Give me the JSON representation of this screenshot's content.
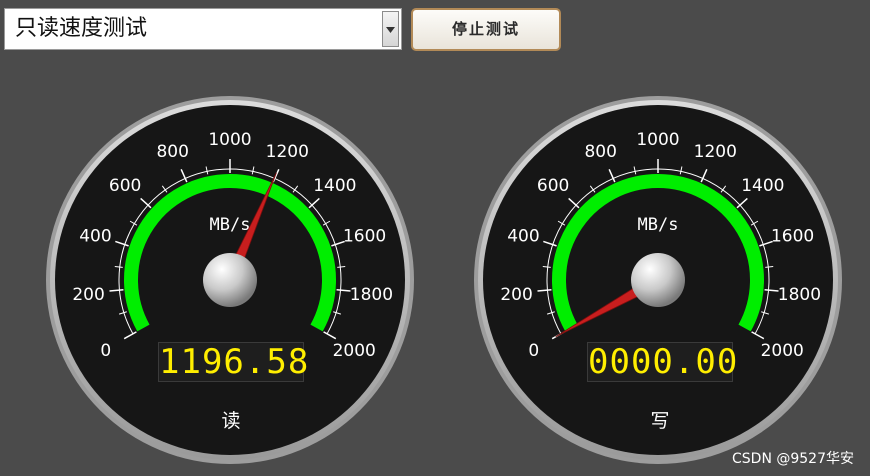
{
  "mode_select": {
    "value": "只读速度测试"
  },
  "stop_button": {
    "label": "停止测试"
  },
  "gauges": [
    {
      "id": "read",
      "label": "读",
      "display": "1196.58",
      "value": 1196.58,
      "unit": "MB/s"
    },
    {
      "id": "write",
      "label": "写",
      "display": "0000.00",
      "value": 0,
      "unit": "MB/s"
    }
  ],
  "scale": {
    "min": 0,
    "max": 2000,
    "ticks": [
      "0",
      "200",
      "400",
      "600",
      "800",
      "1000",
      "1200",
      "1400",
      "1600",
      "1800",
      "2000"
    ]
  },
  "colors": {
    "background": "#4b4b4b",
    "arc": "#00ee00",
    "needle": "#c81e1e",
    "lcd_text": "#ffee00"
  },
  "watermark": "CSDN @9527华安"
}
